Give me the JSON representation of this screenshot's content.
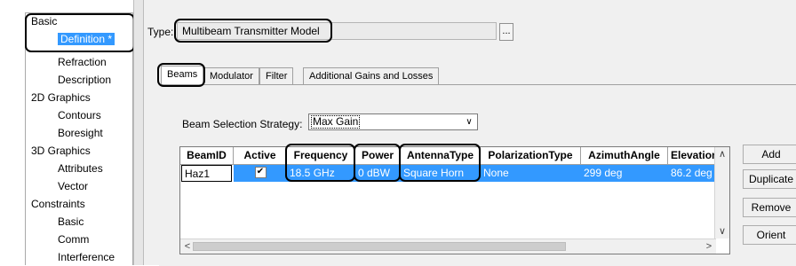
{
  "sidebar": {
    "items": [
      {
        "label": "Basic",
        "level": 0
      },
      {
        "label": "Definition *",
        "level": 1,
        "selected": true
      },
      {
        "label": "Refraction",
        "level": 1
      },
      {
        "label": "Description",
        "level": 1
      },
      {
        "label": "2D Graphics",
        "level": 0
      },
      {
        "label": "Contours",
        "level": 1
      },
      {
        "label": "Boresight",
        "level": 1
      },
      {
        "label": "3D Graphics",
        "level": 0
      },
      {
        "label": "Attributes",
        "level": 1
      },
      {
        "label": "Vector",
        "level": 1
      },
      {
        "label": "Constraints",
        "level": 0
      },
      {
        "label": "Basic",
        "level": 1
      },
      {
        "label": "Comm",
        "level": 1
      },
      {
        "label": "Interference",
        "level": 1
      }
    ]
  },
  "type_row": {
    "label": "Type:",
    "value": "Multibeam Transmitter Model",
    "browse_label": "..."
  },
  "tabs": [
    {
      "label": "Beams",
      "active": true
    },
    {
      "label": "Modulator"
    },
    {
      "label": "Filter"
    },
    {
      "label": "Additional Gains and Losses"
    }
  ],
  "strategy": {
    "label": "Beam Selection Strategy:",
    "value": "Max Gain"
  },
  "grid": {
    "columns": [
      "BeamID",
      "Active",
      "Frequency",
      "Power",
      "AntennaType",
      "PolarizationType",
      "AzimuthAngle",
      "Elevation"
    ],
    "rows": [
      {
        "BeamID": "Haz1",
        "Active": "✔",
        "Frequency": "18.5 GHz",
        "Power": "0 dBW",
        "AntennaType": "Square Horn",
        "PolarizationType": "None",
        "AzimuthAngle": "299 deg",
        "Elevation": "86.2 deg"
      }
    ]
  },
  "buttons": {
    "add": "Add",
    "duplicate": "Duplicate",
    "remove": "Remove",
    "orient": "Orient"
  },
  "icons": {
    "scroll_up": "scroll-up-icon",
    "scroll_down": "scroll-down-icon",
    "scroll_left": "scroll-left-icon",
    "scroll_right": "scroll-right-icon",
    "dropdown": "chevron-down-icon"
  },
  "colors": {
    "selection": "#3399ff",
    "annotation": "#000000"
  }
}
